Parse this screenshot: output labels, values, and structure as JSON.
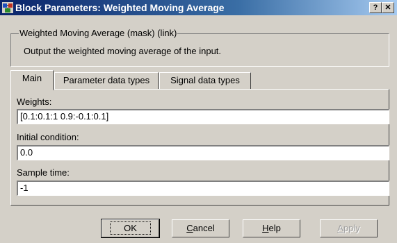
{
  "window": {
    "title": "Block Parameters: Weighted Moving Average",
    "help_glyph": "?",
    "close_glyph": "✕"
  },
  "group": {
    "label": "Weighted Moving Average (mask) (link)",
    "description": "Output the weighted moving average of the input."
  },
  "tabs": [
    {
      "label": "Main",
      "active": true
    },
    {
      "label": "Parameter data types",
      "active": false
    },
    {
      "label": "Signal data types",
      "active": false
    }
  ],
  "fields": {
    "weights": {
      "label": "Weights:",
      "value": "[0.1:0.1:1 0.9:-0.1:0.1]"
    },
    "initial_condition": {
      "label": "Initial condition:",
      "value": "0.0"
    },
    "sample_time": {
      "label": "Sample time:",
      "value": "-1"
    }
  },
  "buttons": {
    "ok": "OK",
    "cancel_first": "C",
    "cancel_rest": "ancel",
    "help_first": "H",
    "help_rest": "elp",
    "apply_first": "A",
    "apply_rest": "pply"
  },
  "colors": {
    "titlebar_start": "#0a246a",
    "titlebar_end": "#a6caf0",
    "face": "#d4d0c8"
  },
  "icons": {
    "app": "simulink-block-icon",
    "help": "help-icon",
    "close": "close-icon"
  }
}
